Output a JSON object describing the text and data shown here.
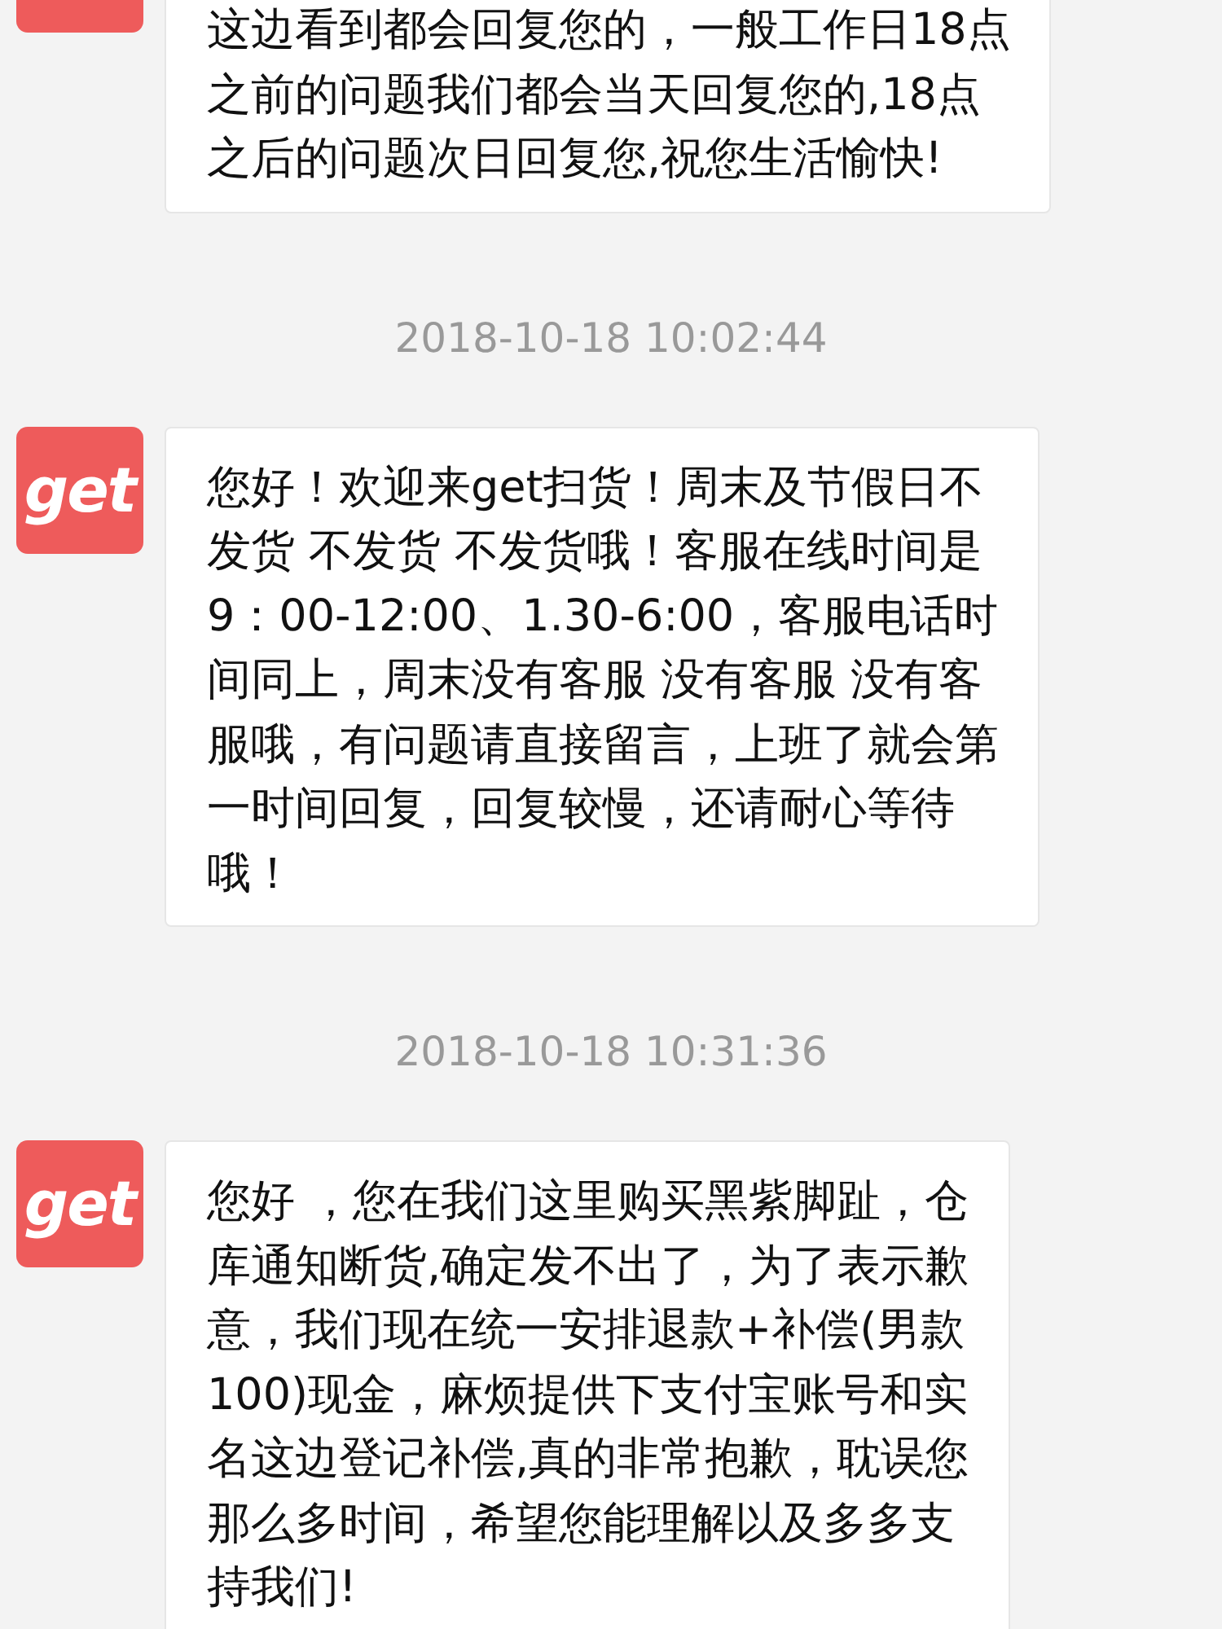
{
  "messages": [
    {
      "kind": "message",
      "lines": [
        "这边看到都会回复您的，一般工作日18点",
        "之前的问题我们都会当天回复您的,18点",
        "之后的问题次日回复您,祝您生活愉快!"
      ]
    },
    {
      "kind": "time",
      "text": "2018-10-18 10:02:44"
    },
    {
      "kind": "message",
      "avatar_text": "get",
      "lines": [
        "您好！欢迎来get扫货！周末及节假日不",
        "发货 不发货 不发货哦！客服在线时间是",
        "9：00-12:00、1.30-6:00，客服电话时",
        "间同上，周末没有客服 没有客服 没有客",
        "服哦，有问题请直接留言，上班了就会第",
        "一时间回复，回复较慢，还请耐心等待",
        "哦！"
      ]
    },
    {
      "kind": "time",
      "text": "2018-10-18 10:31:36"
    },
    {
      "kind": "message",
      "avatar_text": "get",
      "lines": [
        "您好 ，您在我们这里购买黑紫脚趾，仓",
        "库通知断货,确定发不出了，为了表示歉",
        "意，我们现在统一安排退款+补偿(男款",
        "100)现金，麻烦提供下支付宝账号和实",
        "名这边登记补偿,真的非常抱歉，耽误您",
        "那么多时间，希望您能理解以及多多支",
        "持我们!"
      ]
    }
  ]
}
